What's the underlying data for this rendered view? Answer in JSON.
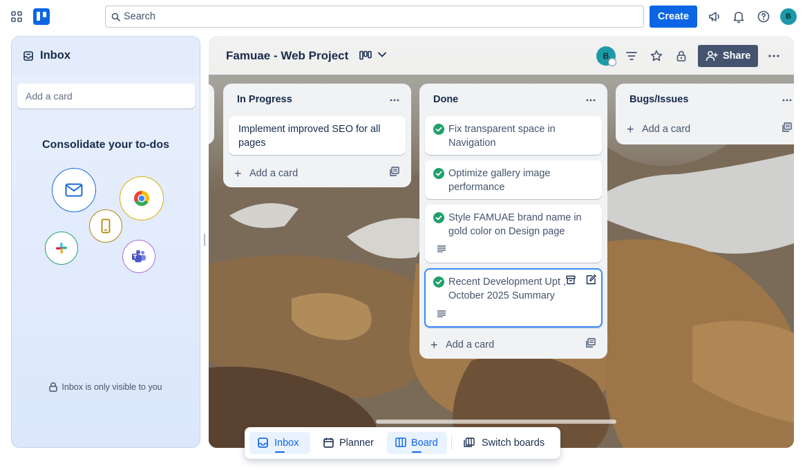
{
  "topbar": {
    "search_placeholder": "Search",
    "create_label": "Create",
    "avatar_initial": "B"
  },
  "inbox": {
    "title": "Inbox",
    "add_card_placeholder": "Add a card",
    "consolidate_heading": "Consolidate your to-dos",
    "privacy_note": "Inbox is only visible to you",
    "sources": [
      "email-icon",
      "chrome-icon",
      "phone-icon",
      "slack-icon",
      "teams-icon"
    ]
  },
  "board": {
    "title": "Famuae - Web Project",
    "avatar_initial": "B",
    "share_label": "Share",
    "lists": [
      {
        "title": "In Progress",
        "cards": [
          {
            "text": "Implement improved SEO for all pages",
            "done": false,
            "has_description": false
          }
        ],
        "add_label": "Add a card"
      },
      {
        "title": "Done",
        "cards": [
          {
            "text": "Fix transparent space in Navigation",
            "done": true,
            "has_description": false
          },
          {
            "text": "Optimize gallery image performance",
            "done": true,
            "has_description": false
          },
          {
            "text": "Style FAMUAE brand name in gold color on Design page",
            "done": true,
            "has_description": true
          },
          {
            "text": "Recent Development Upt    ,t October 2025 Summary",
            "done": true,
            "has_description": true,
            "hovered": true
          }
        ],
        "add_label": "Add a card"
      },
      {
        "title": "Bugs/Issues",
        "cards": [],
        "add_label": "Add a card"
      }
    ]
  },
  "bottom_nav": {
    "items": [
      {
        "label": "Inbox",
        "active": true
      },
      {
        "label": "Planner",
        "active": false
      },
      {
        "label": "Board",
        "active": true
      },
      {
        "label": "Switch boards",
        "active": false
      }
    ]
  },
  "colors": {
    "brand": "#0c66e4",
    "done_check": "#22a06b",
    "avatar": "#1d9aaa"
  }
}
